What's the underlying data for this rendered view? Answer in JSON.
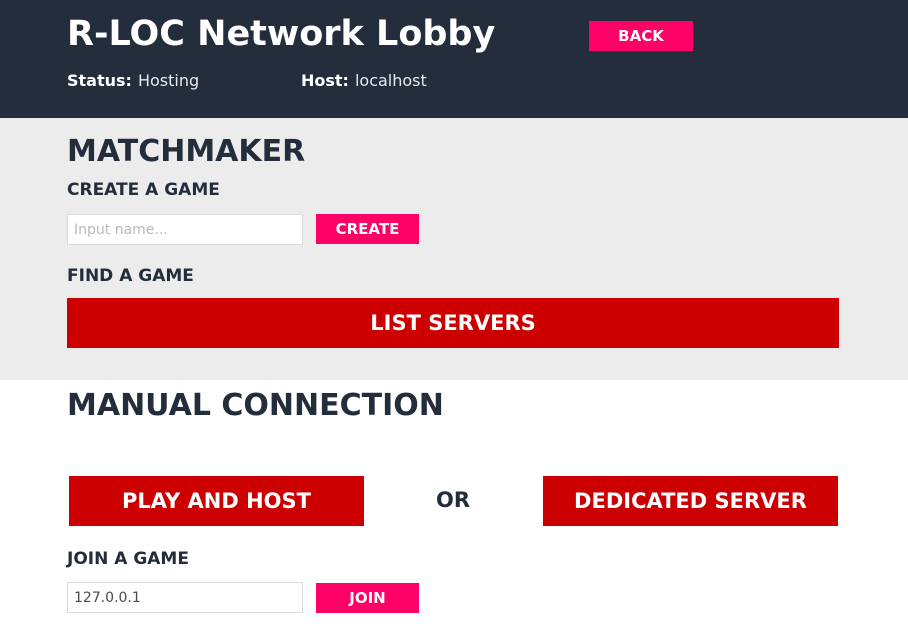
{
  "header": {
    "title": "R-LOC Network Lobby",
    "back_label": "BACK",
    "status_label": "Status:",
    "status_value": "Hosting",
    "host_label": "Host:",
    "host_value": "localhost"
  },
  "matchmaker": {
    "title": "MATCHMAKER",
    "create_heading": "CREATE A GAME",
    "name_placeholder": "Input name...",
    "name_value": "",
    "create_label": "CREATE",
    "find_heading": "FIND A GAME",
    "list_servers_label": "LIST SERVERS"
  },
  "manual": {
    "title": "MANUAL CONNECTION",
    "play_host_label": "PLAY AND HOST",
    "or_label": "OR",
    "dedicated_label": "DEDICATED SERVER",
    "join_heading": "JOIN A GAME",
    "address_value": "127.0.0.1",
    "join_label": "JOIN"
  },
  "colors": {
    "header_bg": "#232d3b",
    "panel_bg": "#ececec",
    "accent_pink": "#ff0066",
    "accent_red": "#cc0000"
  }
}
